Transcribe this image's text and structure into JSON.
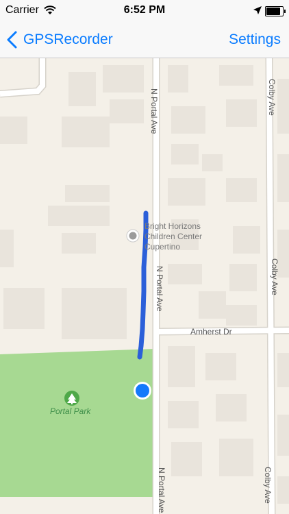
{
  "status_bar": {
    "carrier": "Carrier",
    "time": "6:52 PM",
    "battery_fraction": 0.95,
    "wifi_icon": "wifi-icon",
    "location_icon": "location-arrow-icon"
  },
  "nav": {
    "back_label": "GPSRecorder",
    "back_icon": "chevron-left-icon",
    "settings_label": "Settings",
    "tint_color": "#0a7cff"
  },
  "map": {
    "street_portal_1": "N Portal Ave",
    "street_portal_2": "N Portal Ave",
    "street_portal_3": "N Portal Ave",
    "street_colby_1": "Colby Ave",
    "street_colby_2": "Colby Ave",
    "street_colby_3": "Colby Ave",
    "street_amherst": "Amherst Dr",
    "poi_line1": "Bright Horizons",
    "poi_line2": "Children Center",
    "poi_line3": "Cupertino",
    "park_name": "Portal Park",
    "track_color": "#2b5fd9",
    "user_location_color": "#1479fb",
    "park_color": "#a7d992",
    "poi_icon": "poi-marker-icon",
    "park_icon": "tree-icon"
  }
}
